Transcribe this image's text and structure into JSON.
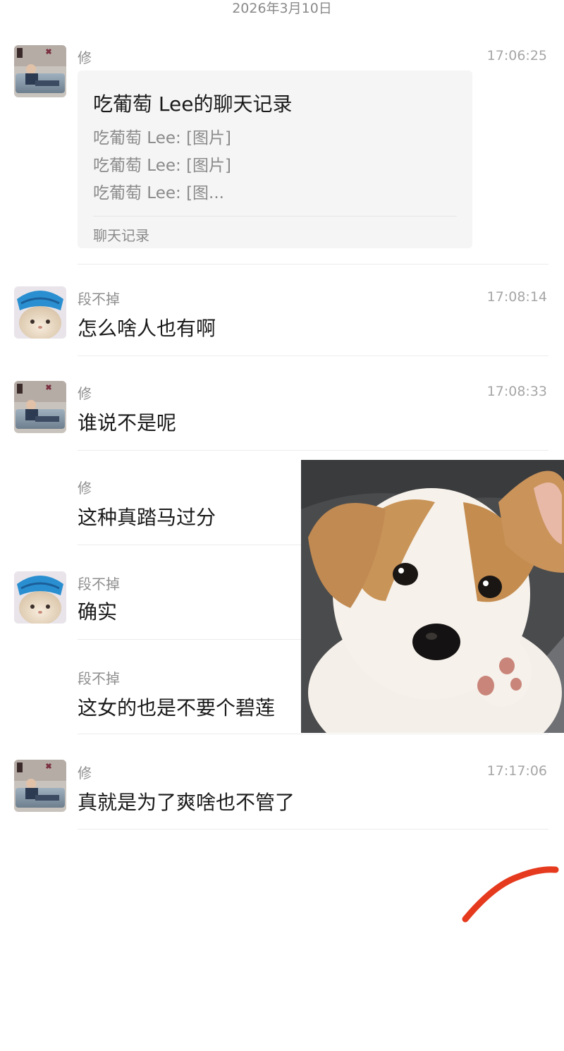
{
  "date_header": "2026年3月10日",
  "messages": [
    {
      "sender": "修",
      "time": "17:06:25",
      "avatar": "avatar-xiu",
      "card": {
        "title": "吃葡萄 Lee的聊天记录",
        "lines": [
          "吃葡萄 Lee: [图片]",
          "吃葡萄 Lee: [图片]",
          "吃葡萄 Lee: [图..."
        ],
        "footer": "聊天记录"
      }
    },
    {
      "sender": "段不掉",
      "time": "17:08:14",
      "avatar": "avatar-duanbudiao",
      "text": "怎么啥人也有啊"
    },
    {
      "sender": "修",
      "time": "17:08:33",
      "avatar": "avatar-xiu",
      "text": "谁说不是呢"
    },
    {
      "sender": "修",
      "text": "这种真踏马过分"
    },
    {
      "sender": "段不掉",
      "avatar": "avatar-duanbudiao",
      "text": "确实"
    },
    {
      "sender": "段不掉",
      "text": "这女的也是不要个碧莲"
    },
    {
      "sender": "修",
      "time": "17:17:06",
      "avatar": "avatar-xiu",
      "text": "真就是为了爽啥也不管了"
    }
  ],
  "sticker": {
    "icon": "corgi-puppy-sticker"
  },
  "annotation": {
    "color": "#e53a1e"
  }
}
